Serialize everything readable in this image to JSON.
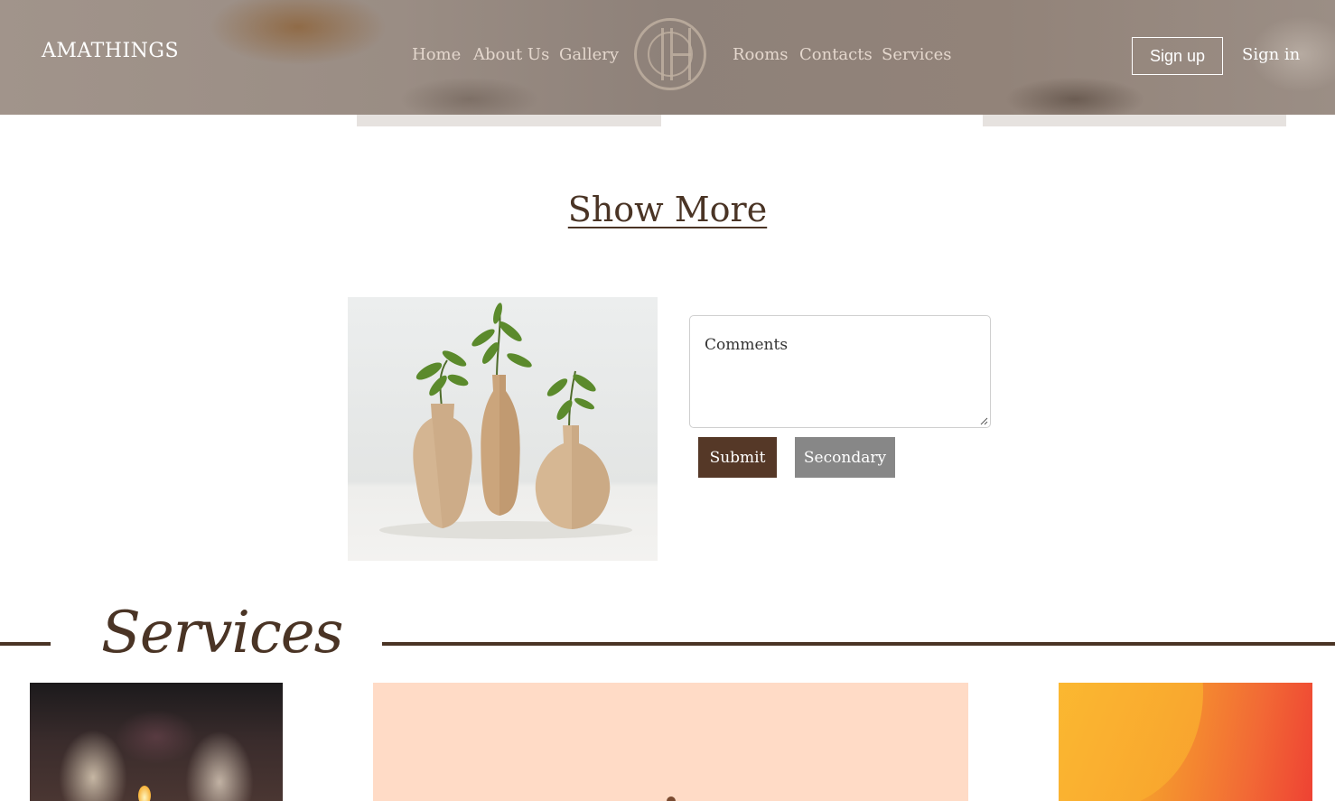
{
  "header": {
    "brand": "AMATHINGS",
    "nav_left": [
      "Home",
      "About Us",
      "Gallery"
    ],
    "nav_right": [
      "Rooms",
      "Contacts",
      "Services"
    ],
    "signup_label": "Sign up",
    "signin_label": "Sign in"
  },
  "show_more_label": "Show More",
  "form": {
    "comments_placeholder": "Comments",
    "submit_label": "Submit",
    "secondary_label": "Secondary"
  },
  "services": {
    "title": "Services"
  },
  "colors": {
    "brand_brown": "#4a3425",
    "submit_bg": "#553827",
    "secondary_bg": "#878787",
    "card_peach": "#ffdbc6"
  }
}
